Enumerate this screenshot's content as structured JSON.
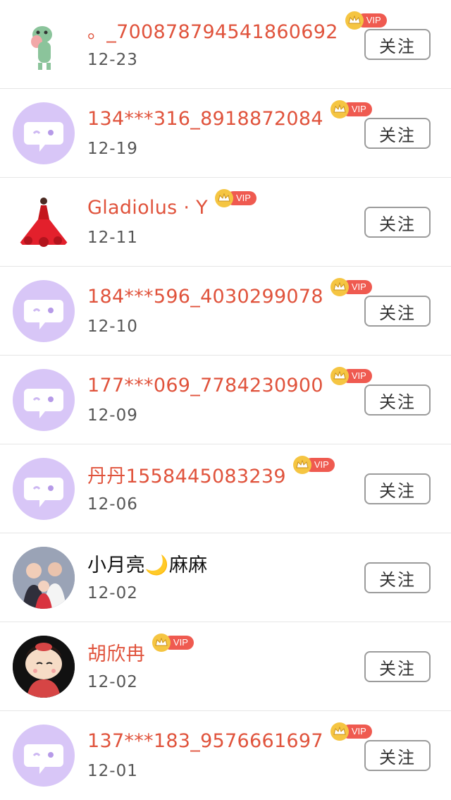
{
  "follow_label": "关注",
  "vip_label": "VIP",
  "colors": {
    "vip_name": "#e0533c",
    "vip_pill": "#ef5a50",
    "crown": "#f5c542",
    "default_avatar_bg": "#d8c6f7"
  },
  "rows": [
    {
      "name": "。_700878794541860692",
      "date": "12-23",
      "vip": true,
      "avatar": "frog-sticker-avatar"
    },
    {
      "name": "134***316_8918872084",
      "date": "12-19",
      "vip": true,
      "avatar": "default-chat-avatar"
    },
    {
      "name": "Gladiolus · Y",
      "date": "12-11",
      "vip": true,
      "avatar": "red-dress-avatar"
    },
    {
      "name": "184***596_4030299078",
      "date": "12-10",
      "vip": true,
      "avatar": "default-chat-avatar"
    },
    {
      "name": "177***069_7784230900",
      "date": "12-09",
      "vip": true,
      "avatar": "default-chat-avatar"
    },
    {
      "name": "丹丹1558445083239",
      "date": "12-06",
      "vip": true,
      "avatar": "default-chat-avatar"
    },
    {
      "name": "小月亮🌙麻麻",
      "date": "12-02",
      "vip": false,
      "avatar": "family-photo-avatar"
    },
    {
      "name": "胡欣冉",
      "date": "12-02",
      "vip": true,
      "avatar": "cartoon-girl-avatar"
    },
    {
      "name": "137***183_9576661697",
      "date": "12-01",
      "vip": true,
      "avatar": "default-chat-avatar"
    }
  ]
}
